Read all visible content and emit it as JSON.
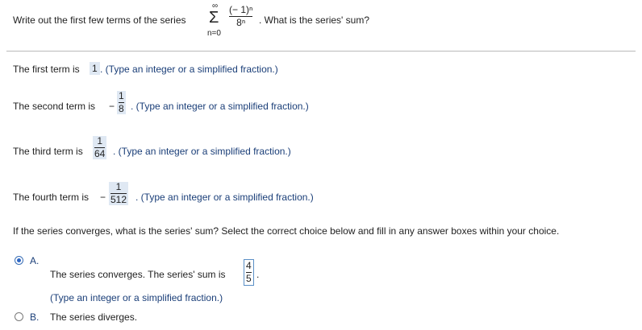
{
  "question": {
    "prefix": "Write out the first few terms of the series",
    "sigma_upper": "∞",
    "sigma_symbol": "Σ",
    "sigma_lower": "n=0",
    "term_numerator": "(− 1)ⁿ",
    "term_denominator": "8ⁿ",
    "suffix": ". What is the series' sum?"
  },
  "first_term": {
    "label": "The first term is",
    "answer": "1",
    "hint": ". (Type an integer or a simplified fraction.)"
  },
  "second_term": {
    "label": "The second term is",
    "sign": "−",
    "numerator": "1",
    "denominator": "8",
    "hint": ". (Type an integer or a simplified fraction.)"
  },
  "third_term": {
    "label": "The third term is",
    "numerator": "1",
    "denominator": "64",
    "hint": ". (Type an integer or a simplified fraction.)"
  },
  "fourth_term": {
    "label": "The fourth term is",
    "sign": "−",
    "numerator": "1",
    "denominator": "512",
    "hint": ". (Type an integer or a simplified fraction.)"
  },
  "converge_question": "If the series converges, what is the series' sum? Select the correct choice below and fill in any answer boxes within your choice.",
  "choice_a": {
    "letter": "A.",
    "text": "The series converges. The series' sum is",
    "numerator": "4",
    "denominator": "5",
    "period": ".",
    "hint": "(Type an integer or a simplified fraction.)",
    "selected": true
  },
  "choice_b": {
    "letter": "B.",
    "text": "The series diverges.",
    "selected": false
  }
}
